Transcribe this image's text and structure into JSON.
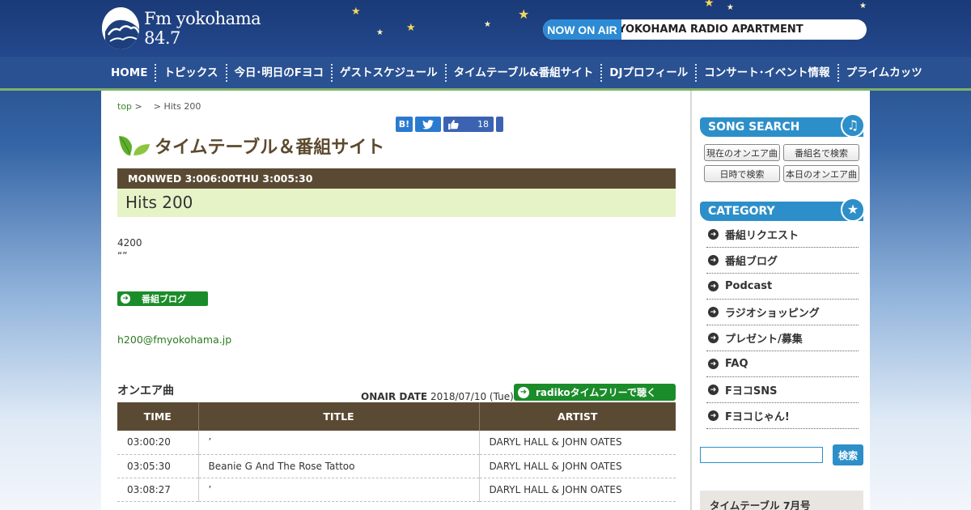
{
  "header": {
    "logo_text": "Fm yokohama 84.7",
    "onair_label": "NOW ON AIR",
    "onair_program": "YOKOHAMA RADIO APARTMENT"
  },
  "nav": {
    "items": [
      "HOME",
      "トピックス",
      "今日･明日のFヨコ",
      "ゲストスケジュール",
      "タイムテーブル&番組サイト",
      "DJプロフィール",
      "コンサート･イベント情報",
      "プライムカッツ"
    ]
  },
  "breadcrumb": {
    "top": "top",
    "sep1": ">",
    "sep2": ">",
    "current": "Hits 200"
  },
  "share": {
    "hatena": "B!",
    "like_count": "18"
  },
  "page_heading": "タイムテーブル＆番組サイト",
  "program": {
    "time": "MONWED 3:006:00THU 3:005:30",
    "title": "Hits 200",
    "desc_line1": "4200",
    "desc_line2": "“”",
    "blog_button": "番組ブログ",
    "email": "h200@fmyokohama.jp"
  },
  "onair": {
    "heading": "オンエア曲",
    "date_label": "ONAIR DATE",
    "date_value": "2018/07/10 (Tue)",
    "radiko_button": "radikoタイムフリーで聴く",
    "columns": [
      "TIME",
      "TITLE",
      "ARTIST"
    ],
    "rows": [
      {
        "time": "03:00:20",
        "title": "’",
        "artist": "DARYL HALL & JOHN OATES"
      },
      {
        "time": "03:05:30",
        "title": "Beanie G And The Rose Tattoo",
        "artist": "DARYL HALL & JOHN OATES"
      },
      {
        "time": "03:08:27",
        "title": "’",
        "artist": "DARYL HALL & JOHN OATES"
      }
    ]
  },
  "sidebar": {
    "song_search_title": "SONG SEARCH",
    "song_buttons": [
      "現在のオンエア曲",
      "番組名で検索",
      "日時で検索",
      "本日のオンエア曲"
    ],
    "category_title": "CATEGORY",
    "categories": [
      "番組リクエスト",
      "番組ブログ",
      "Podcast",
      "ラジオショッピング",
      "プレゼント/募集",
      "FAQ",
      "FヨコSNS",
      "Fヨコじゃん!"
    ],
    "search_button": "検索",
    "timetable_label": "タイムテーブル 7月号"
  },
  "colors": {
    "header_blue": "#1d3f7c",
    "accent_blue": "#2d8fc9",
    "green": "#1b8c2a",
    "brown": "#5b4a33"
  }
}
